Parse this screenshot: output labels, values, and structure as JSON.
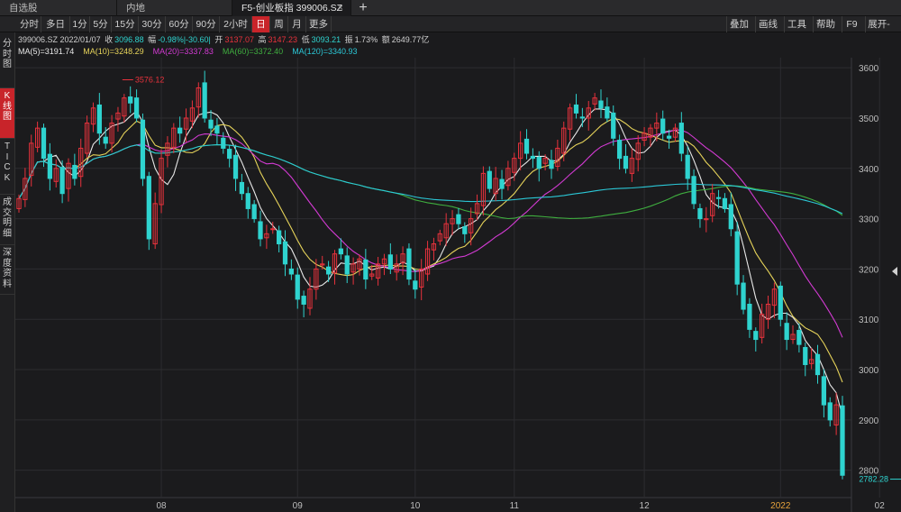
{
  "tabs": [
    {
      "label": "自选股"
    },
    {
      "label": "内地"
    },
    {
      "label": "F5-创业板指 399006.SZ",
      "close": "×",
      "active": true
    }
  ],
  "new_tab_symbol": "+",
  "periods": [
    "分时",
    "多日",
    "1分",
    "5分",
    "15分",
    "30分",
    "60分",
    "90分",
    "2小时",
    "日",
    "周",
    "月",
    "更多"
  ],
  "active_period": "日",
  "right_tools": [
    "叠加",
    "画线",
    "工具",
    "帮助",
    "F9",
    "展开-"
  ],
  "side_tabs": [
    "分时图",
    "K线图",
    "TICK",
    "成交明细",
    "深度资料"
  ],
  "active_side_tab": "K线图",
  "info": {
    "code_date": "399006.SZ 2022/01/07",
    "close_label": "收",
    "close_value": "3096.88",
    "change_label": "幅",
    "change_value": "-0.98%|-30.60|",
    "open_label": "开",
    "open_value": "3137.07",
    "high_label": "高",
    "high_value": "3147.23",
    "low_label": "低",
    "low_value": "3093.21",
    "amp_label": "振",
    "amp_value": "1.73%",
    "amount_label": "额",
    "amount_value": "2649.77亿"
  },
  "ma_labels": [
    {
      "text": "MA(5)=3191.74",
      "color": "#e8e8e8"
    },
    {
      "text": "MA(10)=3248.29",
      "color": "#e6d35a"
    },
    {
      "text": "MA(20)=3337.83",
      "color": "#d23ad2"
    },
    {
      "text": "MA(60)=3372.40",
      "color": "#3fae3f"
    },
    {
      "text": "MA(120)=3340.93",
      "color": "#2bc7d6"
    }
  ],
  "colors": {
    "up": "#e8323c",
    "down": "#2fd3cf",
    "grid": "#2c2c30",
    "axis_text": "#bdbdbd",
    "accent": "#c8242a"
  },
  "chart_data": {
    "type": "candlestick",
    "ylim": [
      2760,
      3620
    ],
    "yticks": [
      2800,
      2900,
      3000,
      3100,
      3200,
      3300,
      3400,
      3500,
      3600
    ],
    "xtick_labels": [
      {
        "label": "08",
        "index": 23
      },
      {
        "label": "09",
        "index": 45
      },
      {
        "label": "10",
        "index": 64
      },
      {
        "label": "11",
        "index": 80
      },
      {
        "label": "12",
        "index": 101
      },
      {
        "label": "2022",
        "index": 123
      },
      {
        "label": "02",
        "index": 139
      }
    ],
    "annotations": [
      {
        "text": "3576.12",
        "index": 17,
        "value": 3576.12,
        "side": "left",
        "color": "#e8323c"
      },
      {
        "text": "2782.28",
        "index": 141,
        "value": 2782.28,
        "side": "left",
        "color": "#2fd3cf"
      }
    ],
    "series_close": [
      3340,
      3380,
      3450,
      3480,
      3420,
      3380,
      3400,
      3350,
      3410,
      3380,
      3440,
      3490,
      3520,
      3470,
      3450,
      3490,
      3510,
      3540,
      3530,
      3500,
      3380,
      3260,
      3330,
      3420,
      3450,
      3480,
      3470,
      3500,
      3520,
      3560,
      3500,
      3480,
      3470,
      3440,
      3420,
      3380,
      3350,
      3320,
      3300,
      3260,
      3270,
      3280,
      3250,
      3210,
      3190,
      3140,
      3130,
      3160,
      3200,
      3210,
      3190,
      3230,
      3230,
      3190,
      3210,
      3220,
      3180,
      3190,
      3210,
      3220,
      3200,
      3210,
      3230,
      3180,
      3160,
      3200,
      3240,
      3250,
      3270,
      3290,
      3300,
      3290,
      3270,
      3300,
      3330,
      3390,
      3360,
      3380,
      3360,
      3400,
      3420,
      3450,
      3430,
      3420,
      3400,
      3420,
      3400,
      3440,
      3480,
      3520,
      3510,
      3500,
      3520,
      3540,
      3520,
      3500,
      3460,
      3420,
      3400,
      3420,
      3450,
      3470,
      3480,
      3490,
      3470,
      3460,
      3480,
      3430,
      3380,
      3330,
      3300,
      3300,
      3350,
      3340,
      3320,
      3280,
      3170,
      3120,
      3080,
      3060,
      3110,
      3130,
      3160,
      3100,
      3060,
      3070,
      3050,
      3010,
      3020,
      2990,
      2930,
      2900,
      2930,
      2790
    ]
  }
}
